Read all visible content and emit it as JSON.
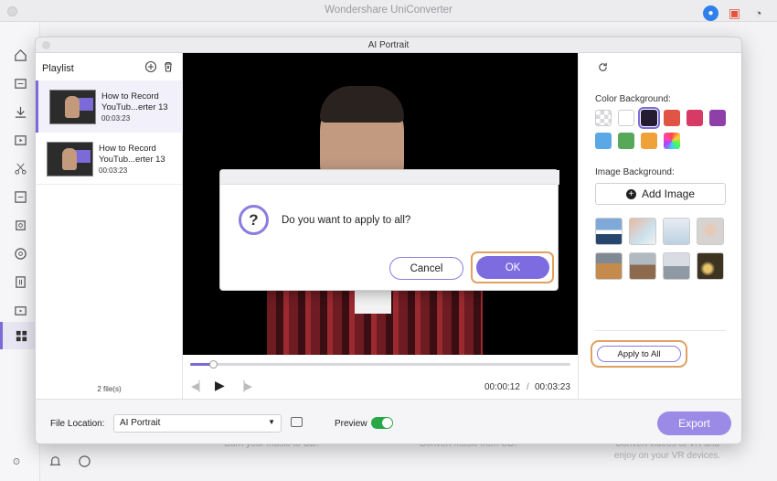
{
  "app": {
    "title": "Wondershare UniConverter"
  },
  "window": {
    "title": "AI Portrait"
  },
  "playlist": {
    "label": "Playlist",
    "items": [
      {
        "title_line1": "How to Record",
        "title_line2": "YouTub...erter 13",
        "duration": "00:03:23"
      },
      {
        "title_line1": "How to Record",
        "title_line2": "YouTub...erter 13",
        "duration": "00:03:23"
      }
    ],
    "count": "2 file(s)"
  },
  "player": {
    "current_time": "00:00:12",
    "separator": "/",
    "total_time": "00:03:23",
    "progress": 0.06
  },
  "right_panel": {
    "color_bg_label": "Color Background:",
    "colors": [
      "transparent",
      "#ffffff",
      "#231c33",
      "#e05446",
      "#d73a64",
      "#8e3fa8",
      "#5aa9e6",
      "#58a85a",
      "#f0a23a",
      "rainbow"
    ],
    "image_bg_label": "Image Background:",
    "add_image_label": "Add Image",
    "apply_all_label": "Apply to All"
  },
  "bottom": {
    "file_location_label": "File Location:",
    "file_location_value": "AI Portrait",
    "preview_label": "Preview",
    "preview_on": true,
    "export_label": "Export"
  },
  "dialog": {
    "message": "Do you want to apply to all?",
    "cancel_label": "Cancel",
    "ok_label": "OK"
  },
  "background_hints": {
    "text1": "Burn your music to CD.",
    "text2": "Convert music from CD.",
    "text3": "Convert videos to VR and",
    "text4": "enjoy on your VR devices."
  }
}
